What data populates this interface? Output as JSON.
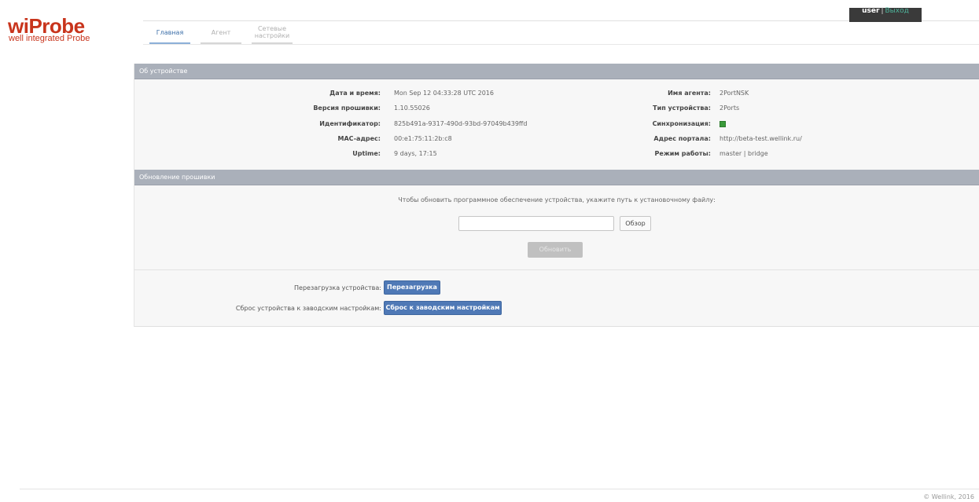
{
  "logo": {
    "main": "wiProbe",
    "sub": "well integrated Probe"
  },
  "tabs": [
    {
      "label": "Главная"
    },
    {
      "label": "Агент"
    },
    {
      "label": "Сетевые настройки"
    }
  ],
  "user": {
    "name": "user",
    "separator": "|",
    "logout": "Выход"
  },
  "device_panel": {
    "title": "Об устройстве",
    "left": [
      {
        "label": "Дата и время:",
        "value": "Mon Sep 12 04:33:28 UTC 2016"
      },
      {
        "label": "Версия прошивки:",
        "value": "1.10.55026"
      },
      {
        "label": "Идентификатор:",
        "value": "825b491a-9317-490d-93bd-97049b439ffd"
      },
      {
        "label": "MAC-адрес:",
        "value": "00:e1:75:11:2b:c8"
      },
      {
        "label": "Uptime:",
        "value": "9 days, 17:15"
      }
    ],
    "right": [
      {
        "label": "Имя агента:",
        "value": "2PortNSK"
      },
      {
        "label": "Тип устройства:",
        "value": "2Ports"
      },
      {
        "label": "Синхронизация:",
        "value": ""
      },
      {
        "label": "Адрес портала:",
        "value": "http://beta-test.wellink.ru/"
      },
      {
        "label": "Режим работы:",
        "value": "master | bridge"
      }
    ],
    "sync_color": "#3a9a3a"
  },
  "firmware_panel": {
    "title": "Обновление прошивки",
    "message": "Чтобы обновить программное обеспечение устройства, укажите путь к установочному файлу:",
    "file_value": "",
    "browse_label": "Обзор",
    "update_label": "Обновить"
  },
  "actions": {
    "reboot_label": "Перезагрузка устройства:",
    "reboot_button": "Перезагрузка",
    "reset_label": "Сброс устройства к заводским настройкам:",
    "reset_button": "Сброс к заводским настройкам"
  },
  "footer": {
    "copyright": "© Wellink, 2016"
  },
  "colors": {
    "brand": "#c8341c",
    "accent": "#4f79b6",
    "header": "#aab0ba"
  }
}
